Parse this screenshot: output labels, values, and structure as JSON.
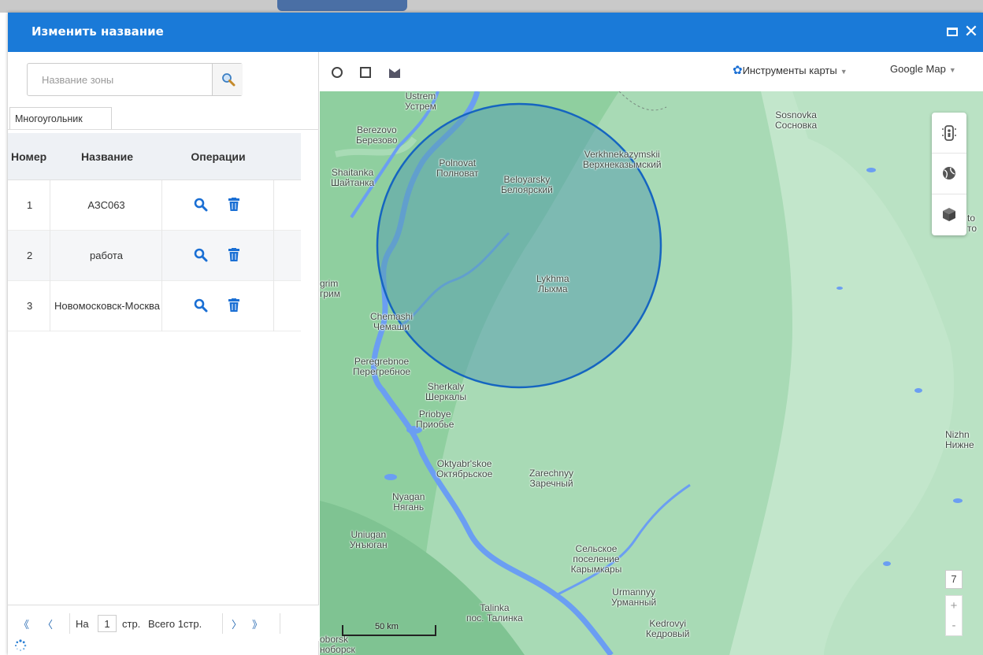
{
  "window": {
    "title": "Изменить название",
    "maximize_icon": "maximize-icon",
    "close_icon": "close-icon"
  },
  "left_panel": {
    "search": {
      "placeholder": "Название зоны",
      "value": "",
      "button_icon": "search-icon"
    },
    "tab": "Многоугольник",
    "columns": [
      "Номер",
      "Название",
      "Операции"
    ],
    "rows": [
      {
        "num": "1",
        "name": "АЗС063"
      },
      {
        "num": "2",
        "name": "работа"
      },
      {
        "num": "3",
        "name": "Новомосковск-Москва"
      }
    ],
    "row_action_icons": [
      "magnifier-icon",
      "trash-icon"
    ],
    "pager": {
      "first_icon": "double-chevron-left-icon",
      "prev_icon": "chevron-left-icon",
      "page_prefix": "На",
      "page_value": "1",
      "page_suffix": "стр.",
      "total": "Всего 1стр.",
      "next_icon": "chevron-right-icon",
      "last_icon": "double-chevron-right-icon"
    }
  },
  "map_toolbar": {
    "draw_tools": [
      "circle-tool-icon",
      "rectangle-tool-icon",
      "polygon-tool-icon"
    ],
    "map_tools_label": "Инструменты карты",
    "map_source_label": "Google Map"
  },
  "map": {
    "labels": [
      {
        "en": "Ustrem",
        "ru": "Устрем"
      },
      {
        "en": "Berezovo",
        "ru": "Березово"
      },
      {
        "en": "Polnovat",
        "ru": "Полноват"
      },
      {
        "en": "Beloyarsky",
        "ru": "Белоярский"
      },
      {
        "en": "Verkhnekazymskii",
        "ru": "Верхнеказымский"
      },
      {
        "en": "Sosnovka",
        "ru": "Сосновка"
      },
      {
        "en": "Shaitanka",
        "ru": "Шайтанка"
      },
      {
        "en": "Lykhma",
        "ru": "Лыхма"
      },
      {
        "en": "Chemashi",
        "ru": "Чемаши"
      },
      {
        "en": "Peregrebnoe",
        "ru": "Перегребное"
      },
      {
        "en": "Sherkaly",
        "ru": "Шеркалы"
      },
      {
        "en": "Priobye",
        "ru": "Приобье"
      },
      {
        "en": "Oktyabr'skoe",
        "ru": "Октябрьское"
      },
      {
        "en": "Zarechnyy",
        "ru": "Заречный"
      },
      {
        "en": "Nyagan",
        "ru": "Нягань"
      },
      {
        "en": "Uniugan",
        "ru": "Унъюган"
      },
      {
        "en": "Сельское",
        "ru": "поселение Карымкары"
      },
      {
        "en": "Urmannyy",
        "ru": "Урманный"
      },
      {
        "en": "Talinka",
        "ru": "пос. Талинка"
      },
      {
        "en": "Kedrovyi",
        "ru": "Кедровый"
      },
      {
        "en": "Nizhn",
        "ru": "Нижне"
      },
      {
        "en": "grim",
        "ru": "грим"
      },
      {
        "en": "oborsk",
        "ru": "нобоpcк"
      },
      {
        "en": "to",
        "ru": "то"
      }
    ],
    "zoom_level": "7",
    "zoom_in": "+",
    "zoom_out": "-",
    "scale_label": "50 km",
    "controls": [
      "street-view-icon",
      "globe-icon",
      "3d-cube-icon"
    ],
    "colors": {
      "land": "#a8dab5",
      "zone": "#5aa0ae",
      "zone_border": "#1565c0",
      "water": "#6b9ef2"
    }
  }
}
